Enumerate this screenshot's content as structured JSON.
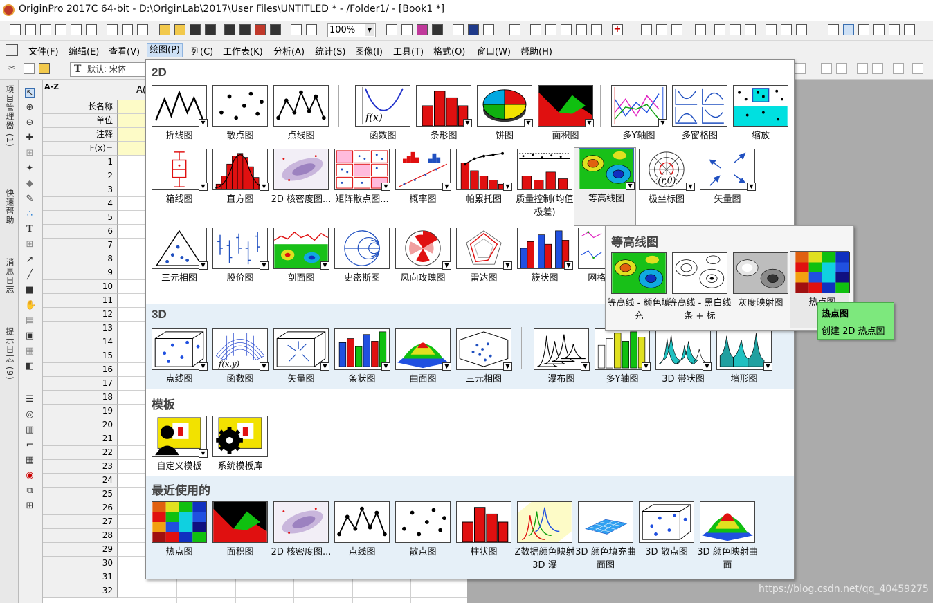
{
  "titlebar": {
    "title": "OriginPro 2017C 64-bit - D:\\OriginLab\\2017\\User Files\\UNTITLED * - /Folder1/ - [Book1 *]"
  },
  "toolbar": {
    "zoom": "100%"
  },
  "menubar": {
    "items": [
      "文件(F)",
      "编辑(E)",
      "查看(V)",
      "绘图(P)",
      "列(C)",
      "工作表(K)",
      "分析(A)",
      "统计(S)",
      "图像(I)",
      "工具(T)",
      "格式(O)",
      "窗口(W)",
      "帮助(H)"
    ]
  },
  "formatbar": {
    "font": "默认: 宋体"
  },
  "dock_tabs": [
    "项目管理器 (1)",
    "快速帮助",
    "消息日志",
    "提示日志 (9)"
  ],
  "sheet": {
    "corner": "A-Z",
    "col_a": "A(",
    "header_rows": [
      "长名称",
      "单位",
      "注释",
      "F(x)="
    ],
    "row_numbers": [
      "1",
      "2",
      "3",
      "4",
      "5",
      "6",
      "7",
      "8",
      "9",
      "10",
      "11",
      "12",
      "13",
      "14",
      "15",
      "16",
      "17",
      "18",
      "19",
      "20",
      "21",
      "22",
      "23",
      "24",
      "25",
      "26",
      "27",
      "28",
      "29",
      "30",
      "31",
      "32"
    ]
  },
  "gallery": {
    "sections": {
      "s2d": "2D",
      "s3d": "3D",
      "templates": "模板",
      "recent": "最近使用的"
    },
    "items_2d_row1": [
      "折线图",
      "散点图",
      "点线图",
      "函数图",
      "条形图",
      "饼图",
      "面积图",
      "多Y轴图",
      "多窗格图",
      "缩放"
    ],
    "items_2d_row2": [
      "箱线图",
      "直方图",
      "2D 核密度图...",
      "矩阵散点图...",
      "概率图",
      "帕累托图",
      "质量控制(均值极差)",
      "等高线图",
      "极坐标图",
      "矢量图"
    ],
    "items_2d_row3": [
      "三元相图",
      "股价图",
      "剖面图",
      "史密斯图",
      "风向玫瑰图",
      "雷达图",
      "簇状图",
      "网格叠..."
    ],
    "items_3d": [
      "点线图",
      "函数图",
      "矢量图",
      "条状图",
      "曲面图",
      "三元相图",
      "瀑布图",
      "多Y轴图",
      "3D 带状图",
      "墙形图"
    ],
    "items_templates": [
      "自定义模板",
      "系统模板库"
    ],
    "items_recent": [
      "热点图",
      "面积图",
      "2D 核密度图...",
      "点线图",
      "散点图",
      "柱状图",
      "Z数据颜色映射 3D 瀑",
      "3D 颜色填充曲面图",
      "3D 散点图",
      "3D 颜色映射曲面"
    ]
  },
  "flyout": {
    "title": "等高线图",
    "items": [
      "等高线 - 颜色填充",
      "等高线 - 黑白线条 + 标",
      "灰度映射图",
      "热点图"
    ]
  },
  "tooltip": {
    "title": "热点图",
    "text": "创建 2D 热点图"
  },
  "watermark": "https://blog.csdn.net/qq_40459275",
  "colors": {
    "menu_highlight": "#cde0f5",
    "gallery_blue": "#e6f0f8",
    "tooltip": "#7de87d",
    "sheet_yellow": "#fdfbc7"
  }
}
